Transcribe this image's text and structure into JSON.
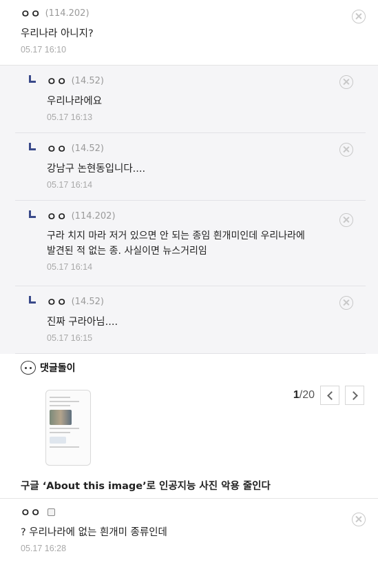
{
  "comments_top": {
    "nick": "ㅇㅇ",
    "ip": "(114.202)",
    "text": "우리나라 아니지?",
    "date": "05.17 16:10"
  },
  "replies": [
    {
      "nick": "ㅇㅇ",
      "ip": "(14.52)",
      "text": "우리나라에요",
      "date": "05.17 16:13"
    },
    {
      "nick": "ㅇㅇ",
      "ip": "(14.52)",
      "text": "강남구 논현동입니다....",
      "date": "05.17 16:14"
    },
    {
      "nick": "ㅇㅇ",
      "ip": "(114.202)",
      "text_line1": "구라 치지 마라 저거 있으면 안 되는 종임 흰개미인데 우리나라에",
      "text_line2": "발견된 적 없는 종. 사실이면 뉴스거리임",
      "date": "05.17 16:14"
    },
    {
      "nick": "ㅇㅇ",
      "ip": "(14.52)",
      "text": "진짜 구라아님....",
      "date": "05.17 16:15"
    }
  ],
  "dc_section": {
    "title": "댓글돌이",
    "pager_current": "1",
    "pager_total": "/20",
    "news_title": "구글 ‘About this image’로 인공지능 사진 악용 줄인다"
  },
  "comment_bottom": {
    "nick": "ㅇㅇ",
    "text": "? 우리나라에 없는 흰개미 종류인데",
    "date": "05.17 16:28"
  },
  "icons": {
    "delete": "close-circle-icon",
    "reply_arrow": "reply-arrow-icon",
    "dc_face": "dcinside-face-icon",
    "prev": "chevron-left-icon",
    "next": "chevron-right-icon",
    "memo": "memo-icon"
  },
  "colors": {
    "reply_bg": "#f5f5f7",
    "reply_arrow": "#3a4a8a",
    "meta_gray": "#a8a8a8"
  }
}
